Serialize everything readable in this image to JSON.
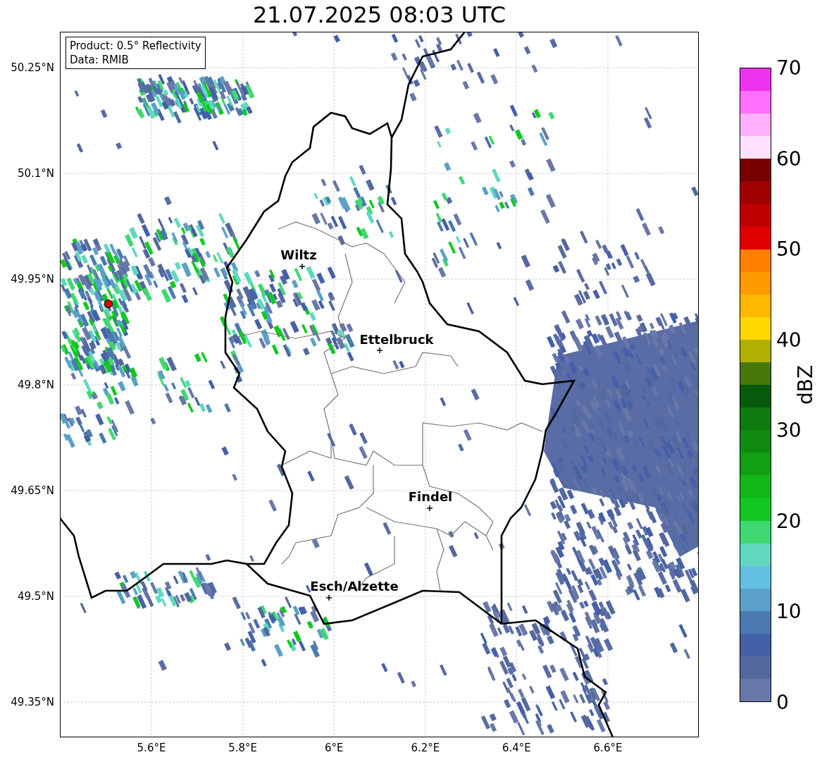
{
  "title": "21.07.2025 08:03 UTC",
  "legend": [
    "Product: 0.5° Reflectivity",
    "Data: RMIB"
  ],
  "cities": [
    {
      "name": "Wiltz"
    },
    {
      "name": "Ettelbruck"
    },
    {
      "name": "Findel"
    },
    {
      "name": "Esch/Alzette"
    }
  ],
  "y_axis": {
    "ticks": [
      "50.25°N",
      "50.1°N",
      "49.95°N",
      "49.8°N",
      "49.65°N",
      "49.5°N",
      "49.35°N"
    ]
  },
  "x_axis": {
    "ticks": [
      "5.6°E",
      "5.8°E",
      "6°E",
      "6.2°E",
      "6.4°E",
      "6.6°E"
    ]
  },
  "colorbar": {
    "label": "dBZ",
    "ticks": [
      "70",
      "60",
      "50",
      "40",
      "30",
      "20",
      "10",
      "0"
    ],
    "segments": [
      {
        "color": "#ee33ee"
      },
      {
        "color": "#ff70ff"
      },
      {
        "color": "#ffb0ff"
      },
      {
        "color": "#ffe0ff"
      },
      {
        "color": "#7a0000"
      },
      {
        "color": "#a00000"
      },
      {
        "color": "#c00000"
      },
      {
        "color": "#e00000"
      },
      {
        "color": "#ff7f00"
      },
      {
        "color": "#ff9a00"
      },
      {
        "color": "#ffb800"
      },
      {
        "color": "#ffd800"
      },
      {
        "color": "#b0b000"
      },
      {
        "color": "#487808"
      },
      {
        "color": "#065a0a"
      },
      {
        "color": "#0e7a10"
      },
      {
        "color": "#108a10"
      },
      {
        "color": "#12a012"
      },
      {
        "color": "#12b818"
      },
      {
        "color": "#10c820"
      },
      {
        "color": "#40d870"
      },
      {
        "color": "#60d8c0"
      },
      {
        "color": "#64c0e0"
      },
      {
        "color": "#5ba0c8"
      },
      {
        "color": "#4a7ab0"
      },
      {
        "color": "#4560a8"
      },
      {
        "color": "#5468a0"
      },
      {
        "color": "#6878a8"
      }
    ]
  }
}
